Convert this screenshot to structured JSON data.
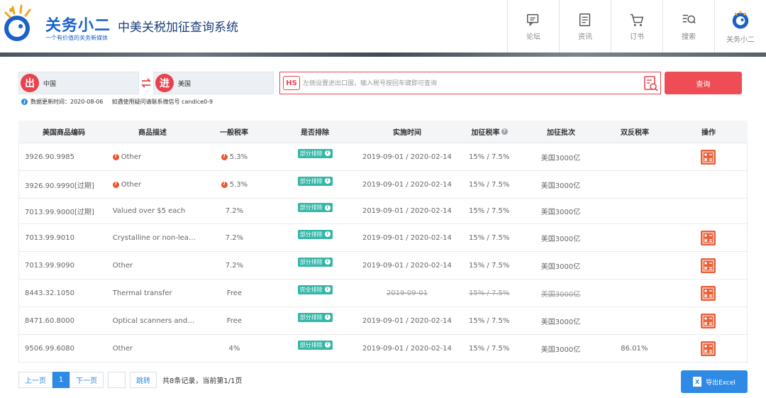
{
  "brand": {
    "name": "关务小二",
    "slogan": "一个有价值的关务新媒体",
    "system_title": "中美关税加征查询系统"
  },
  "nav": [
    {
      "label": "论坛",
      "icon": "forum-icon"
    },
    {
      "label": "资讯",
      "icon": "news-icon"
    },
    {
      "label": "订书",
      "icon": "cart-icon"
    },
    {
      "label": "搜索",
      "icon": "search-icon"
    },
    {
      "label": "关务小二",
      "icon": "avatar-logo-icon"
    }
  ],
  "search": {
    "export_badge": "出",
    "export_country": "中国",
    "import_badge": "进",
    "import_country": "美国",
    "hs_badge": "HS",
    "placeholder": "左侧设置进出口国，输入税号按回车键即可查询",
    "query_label": "查询"
  },
  "info": {
    "updated": "数据更新时间：2020-08-06",
    "contact": "如遇使用疑问请联系微信号 candice0-9"
  },
  "colors": {
    "accent_red": "#ee4d55",
    "primary_blue": "#2f8ae5",
    "tag_teal": "#35b7a8",
    "calc_orange": "#e9603b"
  },
  "table": {
    "headers": [
      "美国商品编码",
      "商品描述",
      "一般税率",
      "是否排除",
      "实施时间",
      "加征税率",
      "加征批次",
      "双反税率",
      "操作"
    ],
    "rows": [
      {
        "code": "3926.90.9985",
        "desc": "Other",
        "desc_warn": true,
        "rate": "5.3%",
        "rate_warn": true,
        "excl": "部分排除",
        "date": "2019-09-01 / 2020-02-14",
        "add": "15% / 7.5%",
        "batch": "美国3000亿",
        "ad": "",
        "calc": true,
        "strike": false
      },
      {
        "code": "3926.90.9990[过期]",
        "desc": "Other",
        "desc_warn": true,
        "rate": "5.3%",
        "rate_warn": true,
        "excl": "部分排除",
        "date": "2019-09-01 / 2020-02-14",
        "add": "15% / 7.5%",
        "batch": "美国3000亿",
        "ad": "",
        "calc": false,
        "strike": false
      },
      {
        "code": "7013.99.9000[过期]",
        "desc": "Valued over $5 each",
        "desc_warn": false,
        "rate": "7.2%",
        "rate_warn": false,
        "excl": "部分排除",
        "date": "2019-09-01 / 2020-02-14",
        "add": "15% / 7.5%",
        "batch": "美国3000亿",
        "ad": "",
        "calc": false,
        "strike": false
      },
      {
        "code": "7013.99.9010",
        "desc": "Crystalline or non-lea…",
        "desc_warn": false,
        "rate": "7.2%",
        "rate_warn": false,
        "excl": "部分排除",
        "date": "2019-09-01 / 2020-02-14",
        "add": "15% / 7.5%",
        "batch": "美国3000亿",
        "ad": "",
        "calc": true,
        "strike": false
      },
      {
        "code": "7013.99.9090",
        "desc": "Other",
        "desc_warn": false,
        "rate": "7.2%",
        "rate_warn": false,
        "excl": "部分排除",
        "date": "2019-09-01 / 2020-02-14",
        "add": "15% / 7.5%",
        "batch": "美国3000亿",
        "ad": "",
        "calc": true,
        "strike": false
      },
      {
        "code": "8443.32.1050",
        "desc": "Thermal transfer",
        "desc_warn": false,
        "rate": "Free",
        "rate_warn": false,
        "excl": "完全排除",
        "date": "2019-09-01",
        "add": "15% / 7.5%",
        "batch": "美国3000亿",
        "ad": "",
        "calc": true,
        "strike": true
      },
      {
        "code": "8471.60.8000",
        "desc": "Optical scanners and…",
        "desc_warn": false,
        "rate": "Free",
        "rate_warn": false,
        "excl": "部分排除",
        "date": "2019-09-01 / 2020-02-14",
        "add": "15% / 7.5%",
        "batch": "美国3000亿",
        "ad": "",
        "calc": true,
        "strike": false
      },
      {
        "code": "9506.99.6080",
        "desc": "Other",
        "desc_warn": false,
        "rate": "4%",
        "rate_warn": false,
        "excl": "部分排除",
        "date": "2019-09-01 / 2020-02-14",
        "add": "15% / 7.5%",
        "batch": "美国3000亿",
        "ad": "86.01%",
        "calc": true,
        "strike": false
      }
    ]
  },
  "pager": {
    "prev": "上一页",
    "current": "1",
    "next": "下一页",
    "page_value": "",
    "jump": "跳转",
    "total": "共8条记录，当前第1/1页"
  },
  "export": {
    "icon_text": "X",
    "label": "导出Excel"
  }
}
